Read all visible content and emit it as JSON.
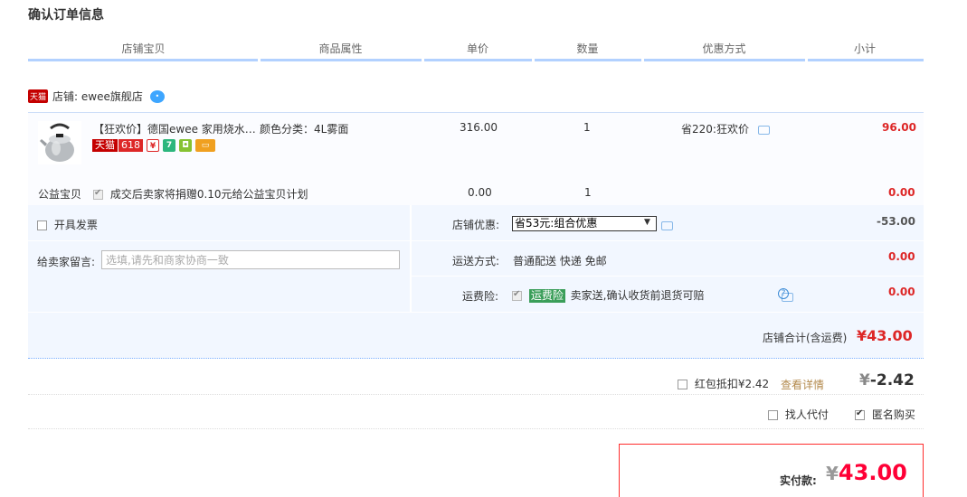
{
  "page_title": "确认订单信息",
  "columns": [
    "店铺宝贝",
    "商品属性",
    "单价",
    "数量",
    "优惠方式",
    "小计"
  ],
  "shop": {
    "badge": "天猫",
    "label": "店铺: ewee旗舰店"
  },
  "item": {
    "title": "【狂欢价】德国ewee 家用烧水…",
    "tmall_badge": "天猫",
    "badge_618": "618",
    "attr": "颜色分类：4L雾面",
    "price": "316.00",
    "qty": "1",
    "discount": "省220:狂欢价",
    "subtotal": "96.00"
  },
  "charity": {
    "label": "公益宝贝",
    "text": "成交后卖家将捐赠0.10元给公益宝贝计划",
    "price": "0.00",
    "qty": "1",
    "subtotal": "0.00"
  },
  "invoice": {
    "label": "开具发票"
  },
  "shop_discount": {
    "label": "店铺优惠:",
    "selected": "省53元:组合优惠",
    "amount": "-53.00"
  },
  "message": {
    "label": "给卖家留言:",
    "placeholder": "选填,请先和商家协商一致"
  },
  "shipping": {
    "label": "运送方式:",
    "value": "普通配送 快递 免邮",
    "amount": "0.00"
  },
  "insurance": {
    "label": "运费险:",
    "tag": "运费险",
    "text": "卖家送,确认收货前退货可赔",
    "amount": "0.00"
  },
  "shop_total": {
    "label": "店铺合计(含运费)",
    "value": "¥43.00"
  },
  "red_packet": {
    "label": "红包抵扣¥2.42",
    "link": "查看详情",
    "value": "-2.42",
    "currency": "¥"
  },
  "options": {
    "proxy": "找人代付",
    "anonymous": "匿名购买"
  },
  "final": {
    "label": "实付款:",
    "currency": "¥",
    "value": "43.00"
  },
  "colors": {
    "accent_red": "#dd2727",
    "header_line": "#b2d1ff",
    "block_bg": "#f2f7ff",
    "link": "#b38a4d"
  }
}
